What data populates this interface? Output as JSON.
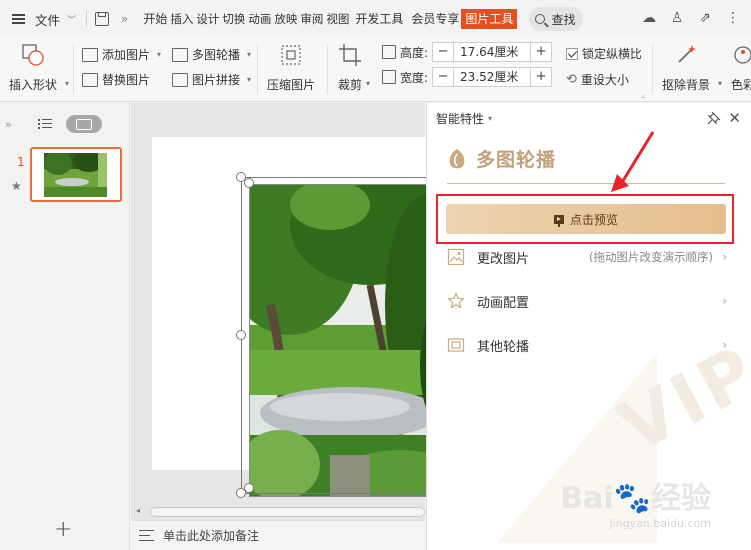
{
  "menubar": {
    "file_label": "文件",
    "tabs": [
      "开始",
      "插入",
      "设计",
      "切换",
      "动画",
      "放映",
      "审阅",
      "视图",
      "开发工具",
      "会员专享"
    ],
    "active_tab": "图片工具",
    "search_label": "查找"
  },
  "ribbon": {
    "insert_shape": "插入形状",
    "add_image": "添加图片",
    "replace_image": "替换图片",
    "multi_carousel": "多图轮播",
    "image_collage": "图片拼接",
    "compress_image": "压缩图片",
    "crop": "裁剪",
    "height_label": "高度:",
    "height_value": "17.64厘米",
    "width_label": "宽度:",
    "width_value": "23.52厘米",
    "lock_ratio": "锁定纵横比",
    "reset_size": "重设大小",
    "remove_bg": "抠除背景",
    "color": "色彩"
  },
  "thumbnails": {
    "slide_number": "1"
  },
  "canvas": {
    "notes_placeholder": "单击此处添加备注"
  },
  "pane": {
    "header": "智能特性",
    "title": "多图轮播",
    "preview_button": "点击预览",
    "options": [
      {
        "label": "更改图片",
        "hint": "(拖动图片改变演示顺序)"
      },
      {
        "label": "动画配置",
        "hint": ""
      },
      {
        "label": "其他轮播",
        "hint": ""
      }
    ],
    "vip_text": "VIP"
  },
  "watermark": {
    "big": "Bai🐾经验",
    "small": "jingyan.baidu.com"
  },
  "colors": {
    "accent": "#e3501f",
    "gold": "#c0a27c",
    "highlight_red": "#e5252a"
  }
}
